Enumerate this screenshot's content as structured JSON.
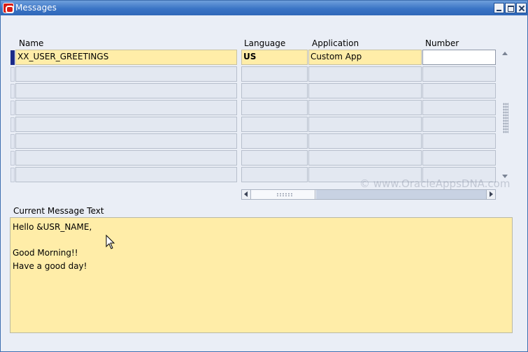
{
  "window": {
    "title": "Messages"
  },
  "columns": {
    "name": "Name",
    "language": "Language",
    "application": "Application",
    "number": "Number"
  },
  "rows": [
    {
      "name": "XX_USER_GREETINGS",
      "language": "US",
      "application": "Custom App",
      "number": ""
    },
    {
      "name": "",
      "language": "",
      "application": "",
      "number": ""
    },
    {
      "name": "",
      "language": "",
      "application": "",
      "number": ""
    },
    {
      "name": "",
      "language": "",
      "application": "",
      "number": ""
    },
    {
      "name": "",
      "language": "",
      "application": "",
      "number": ""
    },
    {
      "name": "",
      "language": "",
      "application": "",
      "number": ""
    },
    {
      "name": "",
      "language": "",
      "application": "",
      "number": ""
    },
    {
      "name": "",
      "language": "",
      "application": "",
      "number": ""
    }
  ],
  "watermark": "© www.OracleAppsDNA.com",
  "message": {
    "label": "Current Message Text",
    "text": "Hello &USR_NAME,\n\nGood Morning!!\nHave a good day!"
  },
  "colors": {
    "titlebar": "#3a74c5",
    "active_field": "#ffeda8",
    "record_indicator": "#1b2b88"
  },
  "icons": [
    "oracle-logo-icon",
    "minimize-icon",
    "maximize-icon",
    "close-icon",
    "scroll-up-icon",
    "scroll-down-icon",
    "scroll-left-icon",
    "scroll-right-icon",
    "mouse-pointer-icon"
  ]
}
